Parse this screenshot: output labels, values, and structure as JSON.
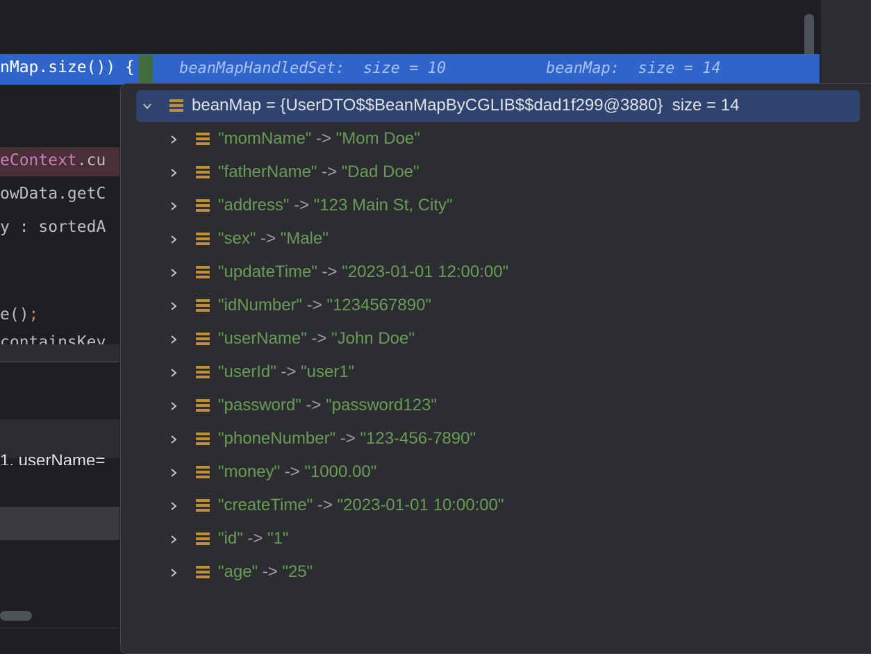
{
  "editor": {
    "highlight_line_code": "nMap.size()) ",
    "highlight_brace": "{",
    "hint_handled_set": "beanMapHandledSet:  size = 10",
    "hint_bean_map": "beanMap:  size = 14",
    "line_context": ".cu",
    "line_context_prefix": "eContext",
    "line_getc": "owData.getC",
    "line_sorted": "y : sortedA",
    "line_call_prefix": "e()",
    "line_call_semicolon": ";",
    "line_contains": "containsKey",
    "line_username": "1, userName="
  },
  "popup": {
    "root_label": "beanMap = {UserDTO$$BeanMapByCGLIB$$dad1f299@3880}  size = 14",
    "entries": [
      {
        "key": "\"momName\"",
        "arrow": " -> ",
        "value": "\"Mom Doe\""
      },
      {
        "key": "\"fatherName\"",
        "arrow": " -> ",
        "value": "\"Dad Doe\""
      },
      {
        "key": "\"address\"",
        "arrow": " -> ",
        "value": "\"123 Main St, City\""
      },
      {
        "key": "\"sex\"",
        "arrow": " -> ",
        "value": "\"Male\""
      },
      {
        "key": "\"updateTime\"",
        "arrow": " -> ",
        "value": "\"2023-01-01 12:00:00\""
      },
      {
        "key": "\"idNumber\"",
        "arrow": " -> ",
        "value": "\"1234567890\""
      },
      {
        "key": "\"userName\"",
        "arrow": " -> ",
        "value": "\"John Doe\""
      },
      {
        "key": "\"userId\"",
        "arrow": " -> ",
        "value": "\"user1\""
      },
      {
        "key": "\"password\"",
        "arrow": " -> ",
        "value": "\"password123\""
      },
      {
        "key": "\"phoneNumber\"",
        "arrow": " -> ",
        "value": "\"123-456-7890\""
      },
      {
        "key": "\"money\"",
        "arrow": " -> ",
        "value": "\"1000.00\""
      },
      {
        "key": "\"createTime\"",
        "arrow": " -> ",
        "value": "\"2023-01-01 10:00:00\""
      },
      {
        "key": "\"id\"",
        "arrow": " -> ",
        "value": "\"1\""
      },
      {
        "key": "\"age\"",
        "arrow": " -> ",
        "value": "\"25\""
      }
    ]
  },
  "icons": {
    "chevron_down": "chevron-down-icon",
    "chevron_right": "chevron-right-icon",
    "map_entry": "map-entry-icon"
  },
  "colors": {
    "highlight": "#2f65ca",
    "root_row": "#2e436e",
    "string_value": "#6a9b57",
    "entry_icon": "#c18f3a"
  }
}
